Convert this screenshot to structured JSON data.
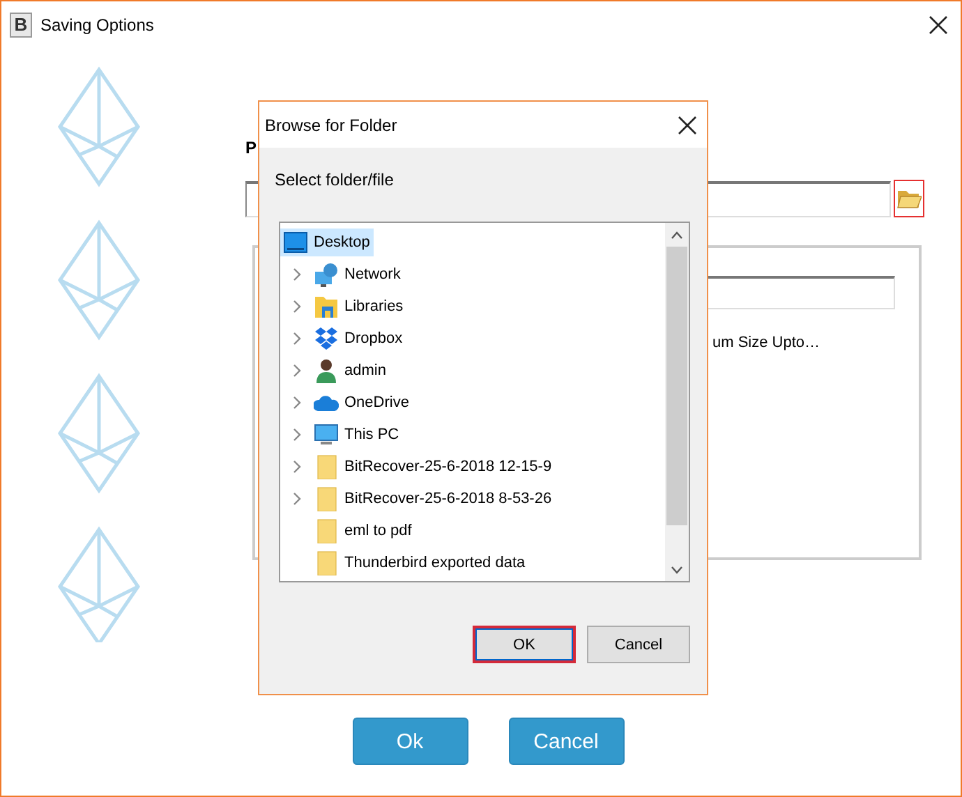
{
  "window": {
    "title": "Saving Options",
    "app_icon": "B"
  },
  "background": {
    "label": "P",
    "size_text": "um Size Upto…"
  },
  "dialog": {
    "title": "Browse for Folder",
    "prompt": "Select folder/file",
    "tree": [
      {
        "label": "Desktop",
        "kind": "desktop",
        "selected": true,
        "expandable": false,
        "children": [
          {
            "label": "Network",
            "kind": "network",
            "selected": false,
            "expandable": true
          },
          {
            "label": "Libraries",
            "kind": "libraries",
            "selected": false,
            "expandable": true
          },
          {
            "label": "Dropbox",
            "kind": "dropbox",
            "selected": false,
            "expandable": true
          },
          {
            "label": "admin",
            "kind": "user",
            "selected": false,
            "expandable": true
          },
          {
            "label": "OneDrive",
            "kind": "cloud",
            "selected": false,
            "expandable": true
          },
          {
            "label": "This PC",
            "kind": "computer",
            "selected": false,
            "expandable": true
          },
          {
            "label": "BitRecover-25-6-2018 12-15-9",
            "kind": "folder",
            "selected": false,
            "expandable": true
          },
          {
            "label": "BitRecover-25-6-2018 8-53-26",
            "kind": "folder",
            "selected": false,
            "expandable": true
          },
          {
            "label": "eml to pdf",
            "kind": "folder",
            "selected": false,
            "expandable": false
          },
          {
            "label": "Thunderbird exported data",
            "kind": "folder",
            "selected": false,
            "expandable": false
          }
        ]
      }
    ],
    "buttons": [
      {
        "label": "OK",
        "focused": true
      },
      {
        "label": "Cancel",
        "focused": false
      }
    ]
  },
  "buttons": [
    "Ok",
    "Cancel"
  ]
}
